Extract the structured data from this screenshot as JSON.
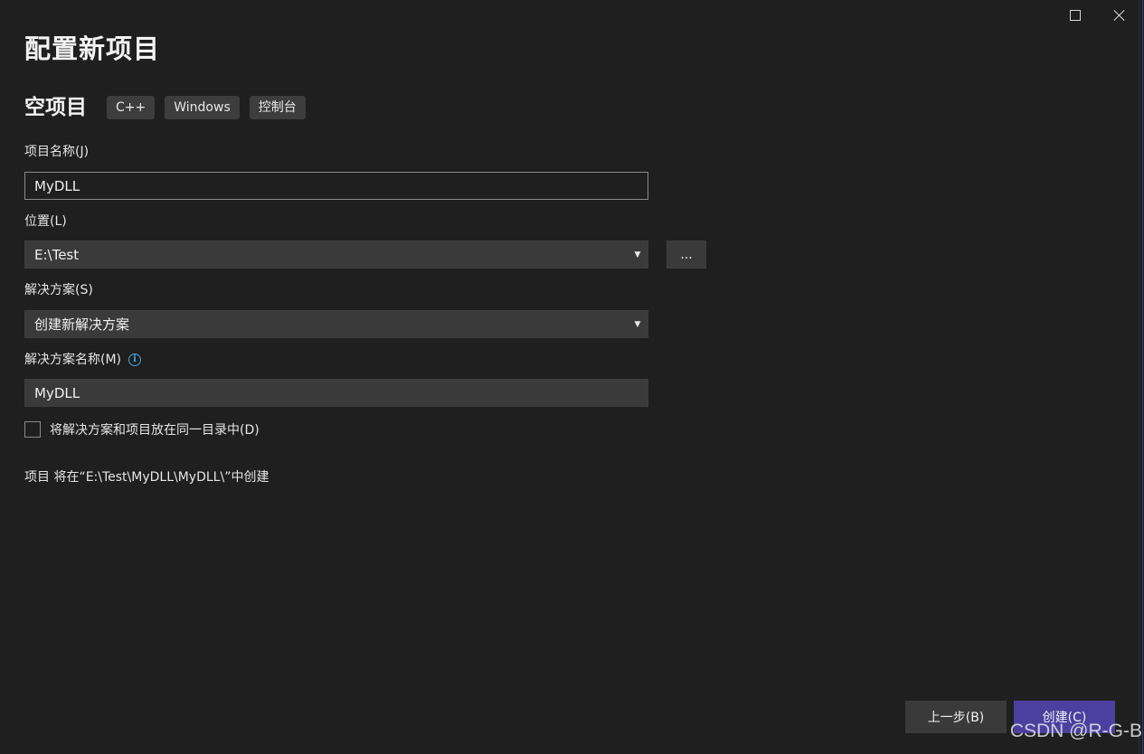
{
  "window": {
    "maximize_icon": "maximize-icon",
    "close_icon": "close-icon"
  },
  "header": {
    "title": "配置新项目"
  },
  "template": {
    "name": "空项目",
    "tags": [
      "C++",
      "Windows",
      "控制台"
    ]
  },
  "form": {
    "project_name_label": "项目名称(J)",
    "project_name_value": "MyDLL",
    "location_label": "位置(L)",
    "location_value": "E:\\Test",
    "browse_label": "...",
    "solution_label": "解决方案(S)",
    "solution_value": "创建新解决方案",
    "solution_name_label": "解决方案名称(M)",
    "solution_name_value": "MyDLL",
    "same_dir_label": "将解决方案和项目放在同一目录中(D)",
    "same_dir_checked": false,
    "path_note": "项目 将在“E:\\Test\\MyDLL\\MyDLL\\”中创建"
  },
  "footer": {
    "back_label": "上一步(B)",
    "create_label": "创建(C)"
  },
  "watermark": "CSDN @R-G-B",
  "colors": {
    "background": "#1f1f1f",
    "field": "#3a3a3a",
    "accent": "#4d3fa0",
    "info": "#4aa3df"
  }
}
